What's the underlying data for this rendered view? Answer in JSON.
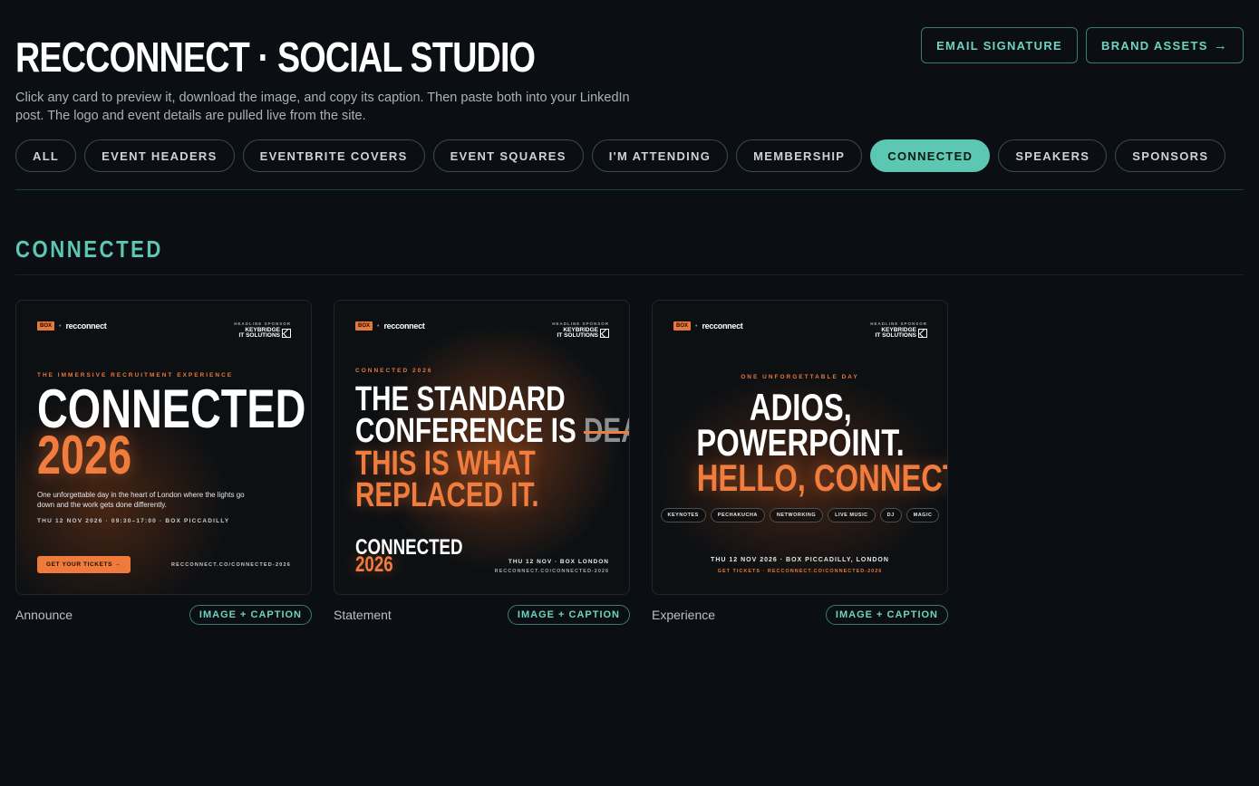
{
  "header": {
    "title": "RECCONNECT · SOCIAL STUDIO",
    "subtitle": "Click any card to preview it, download the image, and copy its caption. Then paste both into your LinkedIn post. The logo and event details are pulled live from the site.",
    "actions": [
      {
        "label": "EMAIL SIGNATURE"
      },
      {
        "label": "BRAND ASSETS",
        "icon": "arrow-right-icon",
        "glyph": "→"
      }
    ]
  },
  "filters": [
    {
      "label": "ALL"
    },
    {
      "label": "EVENT HEADERS"
    },
    {
      "label": "EVENTBRITE COVERS"
    },
    {
      "label": "EVENT SQUARES"
    },
    {
      "label": "I'M ATTENDING"
    },
    {
      "label": "MEMBERSHIP"
    },
    {
      "label": "CONNECTED",
      "active": true
    },
    {
      "label": "SPEAKERS"
    },
    {
      "label": "SPONSORS"
    }
  ],
  "section": {
    "title": "CONNECTED"
  },
  "brand": {
    "box": "BOX",
    "dot": "•",
    "recconnect": "recconnect",
    "sponsor_label": "HEADLINE SPONSOR",
    "sponsor_name_1": "KEYBRIDGE",
    "sponsor_name_2": "IT SOLUTIONS"
  },
  "cards": [
    {
      "name": "Announce",
      "badge": "IMAGE + CAPTION",
      "kicker": "THE IMMERSIVE RECRUITMENT EXPERIENCE",
      "headline_1": "CONNECTED",
      "headline_2": "2026",
      "body": "One unforgettable day in the heart of London where the lights go down and the work gets done differently.",
      "meta": "THU 12 NOV 2026 · 09:30–17:00 · BOX PICCADILLY",
      "cta": "GET YOUR TICKETS →",
      "url": "RECCONNECT.CO/CONNECTED-2026"
    },
    {
      "name": "Statement",
      "badge": "IMAGE + CAPTION",
      "kicker": "CONNECTED 2026",
      "line_1": "THE STANDARD",
      "line_2a": "CONFERENCE IS ",
      "line_2b": "DEAD",
      "line_2c": ".",
      "line_3": "THIS IS WHAT",
      "line_4": "REPLACED IT.",
      "footer_1": "CONNECTED",
      "footer_2": "2026",
      "meta": "THU 12 NOV · BOX LONDON",
      "url": "RECCONNECT.CO/CONNECTED-2026"
    },
    {
      "name": "Experience",
      "badge": "IMAGE + CAPTION",
      "kicker": "ONE UNFORGETTABLE DAY",
      "line_1": "ADIOS,",
      "line_2": "POWERPOINT.",
      "line_3": "HELLO, CONNECTED.",
      "tags": [
        "KEYNOTES",
        "PECHAKUCHA",
        "NETWORKING",
        "LIVE MUSIC",
        "DJ",
        "MAGIC"
      ],
      "meta": "THU 12 NOV 2026 · BOX PICCADILLY, LONDON",
      "url": "GET TICKETS · RECCONNECT.CO/CONNECTED-2026"
    }
  ],
  "colors": {
    "background": "#0b0e12",
    "accent_teal": "#5cc8b4",
    "accent_orange": "#f07c3e"
  }
}
